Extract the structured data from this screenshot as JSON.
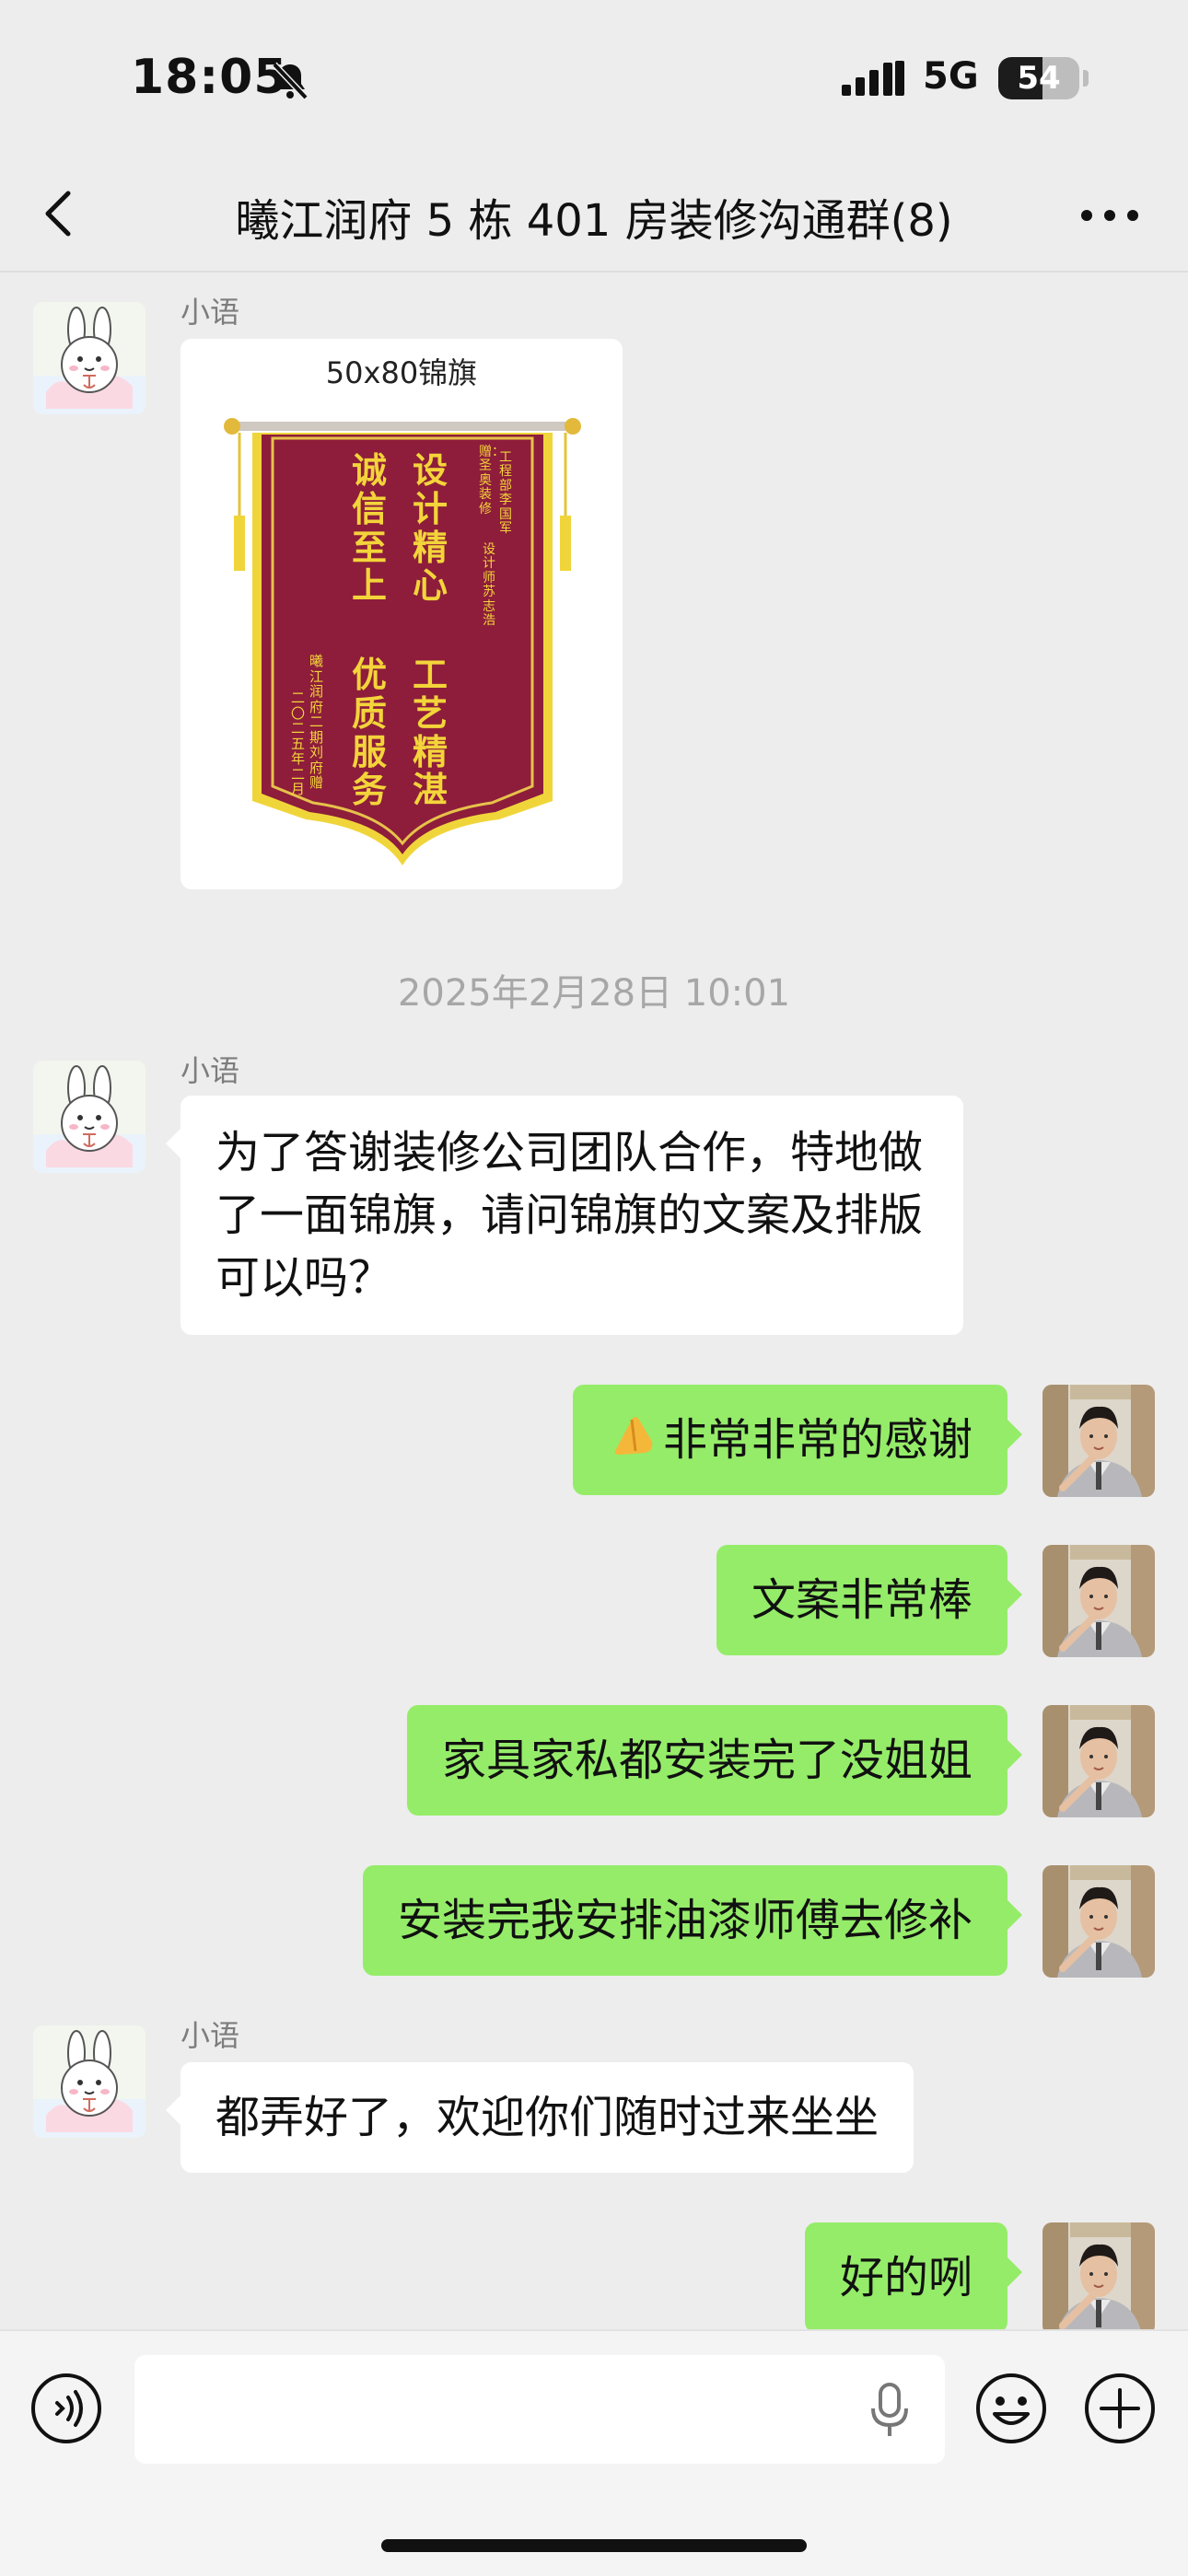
{
  "status_bar": {
    "time": "18:05",
    "network": "5G",
    "battery": "54",
    "battery_level_percent": 54
  },
  "header": {
    "back_icon": "chevron-left-icon",
    "title": "曦江润府 5 栋 401 房装修沟通群(8)",
    "more_icon": "more-dots-icon"
  },
  "messages": {
    "m1_sender": "小语",
    "m1_image_caption": "50x80锦旗",
    "banner": {
      "right_main": "设计精心 工艺精湛",
      "left_main": "诚信至上 优质服务",
      "top_small_1": "赠：圣奥装修",
      "top_small_2": "工程部李国军 设计师苏志浩",
      "bottom_small_1": "曦江润府二期刘府赠",
      "bottom_small_2": "二〇二五年二月"
    },
    "timestamp": "2025年2月28日 10:01",
    "m2_sender": "小语",
    "m2_text": "为了答谢装修公司团队合作，特地做了一面锦旗，请问锦旗的文案及排版可以吗？",
    "m3_text": "非常非常的感谢",
    "m4_text": "文案非常棒",
    "m5_text": "家具家私都安装完了没姐姐",
    "m6_text": "安装完我安排油漆师傅去修补",
    "m7_sender": "小语",
    "m7_text": "都弄好了，欢迎你们随时过来坐坐",
    "m8_text": "好的咧"
  },
  "input_bar": {
    "voice_icon": "voice-mode-icon",
    "mic_icon": "microphone-icon",
    "emoji_icon": "emoji-icon",
    "plus_icon": "plus-icon"
  },
  "colors": {
    "outgoing_bubble": "#95ec69",
    "incoming_bubble": "#ffffff",
    "background": "#ededed"
  }
}
